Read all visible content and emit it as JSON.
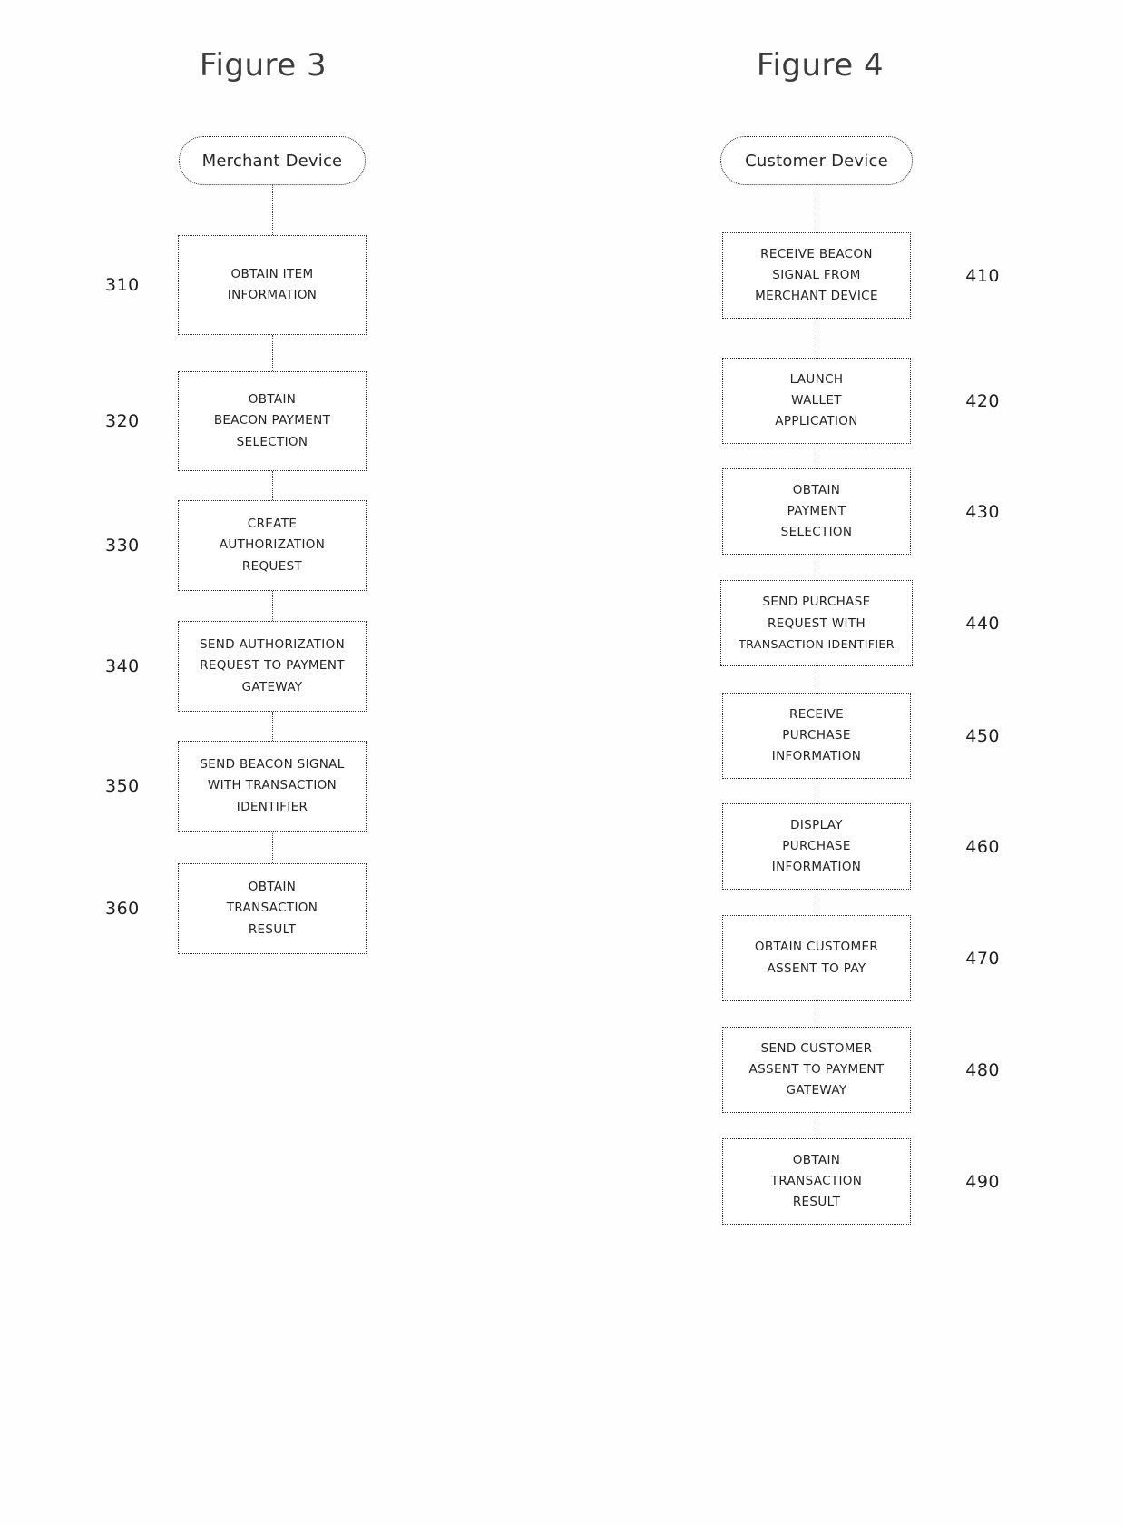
{
  "document": {
    "type": "patent-figure-sheet",
    "figures": [
      {
        "id": "figure-3",
        "title": "Figure 3",
        "start_node": "Merchant Device",
        "ref_side": "left",
        "steps": [
          {
            "ref": "310",
            "lines": [
              "OBTAIN ITEM",
              "INFORMATION"
            ]
          },
          {
            "ref": "320",
            "lines": [
              "OBTAIN",
              "BEACON PAYMENT",
              "SELECTION"
            ]
          },
          {
            "ref": "330",
            "lines": [
              "CREATE",
              "AUTHORIZATION",
              "REQUEST"
            ]
          },
          {
            "ref": "340",
            "lines": [
              "SEND AUTHORIZATION",
              "REQUEST TO PAYMENT",
              "GATEWAY"
            ]
          },
          {
            "ref": "350",
            "lines": [
              "SEND BEACON SIGNAL",
              "WITH TRANSACTION",
              "IDENTIFIER"
            ]
          },
          {
            "ref": "360",
            "lines": [
              "OBTAIN",
              "TRANSACTION",
              "RESULT"
            ]
          }
        ]
      },
      {
        "id": "figure-4",
        "title": "Figure 4",
        "start_node": "Customer Device",
        "ref_side": "right",
        "steps": [
          {
            "ref": "410",
            "lines": [
              "RECEIVE BEACON",
              "SIGNAL FROM",
              "MERCHANT DEVICE"
            ]
          },
          {
            "ref": "420",
            "lines": [
              "LAUNCH",
              "WALLET",
              "APPLICATION"
            ]
          },
          {
            "ref": "430",
            "lines": [
              "OBTAIN",
              "PAYMENT",
              "SELECTION"
            ]
          },
          {
            "ref": "440",
            "lines": [
              "SEND PURCHASE",
              "REQUEST WITH",
              "TRANSACTION IDENTIFIER"
            ]
          },
          {
            "ref": "450",
            "lines": [
              "RECEIVE",
              "PURCHASE",
              "INFORMATION"
            ]
          },
          {
            "ref": "460",
            "lines": [
              "DISPLAY",
              "PURCHASE",
              "INFORMATION"
            ]
          },
          {
            "ref": "470",
            "lines": [
              "OBTAIN CUSTOMER",
              "ASSENT TO PAY"
            ]
          },
          {
            "ref": "480",
            "lines": [
              "SEND CUSTOMER",
              "ASSENT TO PAYMENT",
              "GATEWAY"
            ]
          },
          {
            "ref": "490",
            "lines": [
              "OBTAIN",
              "TRANSACTION",
              "RESULT"
            ]
          }
        ]
      }
    ]
  }
}
